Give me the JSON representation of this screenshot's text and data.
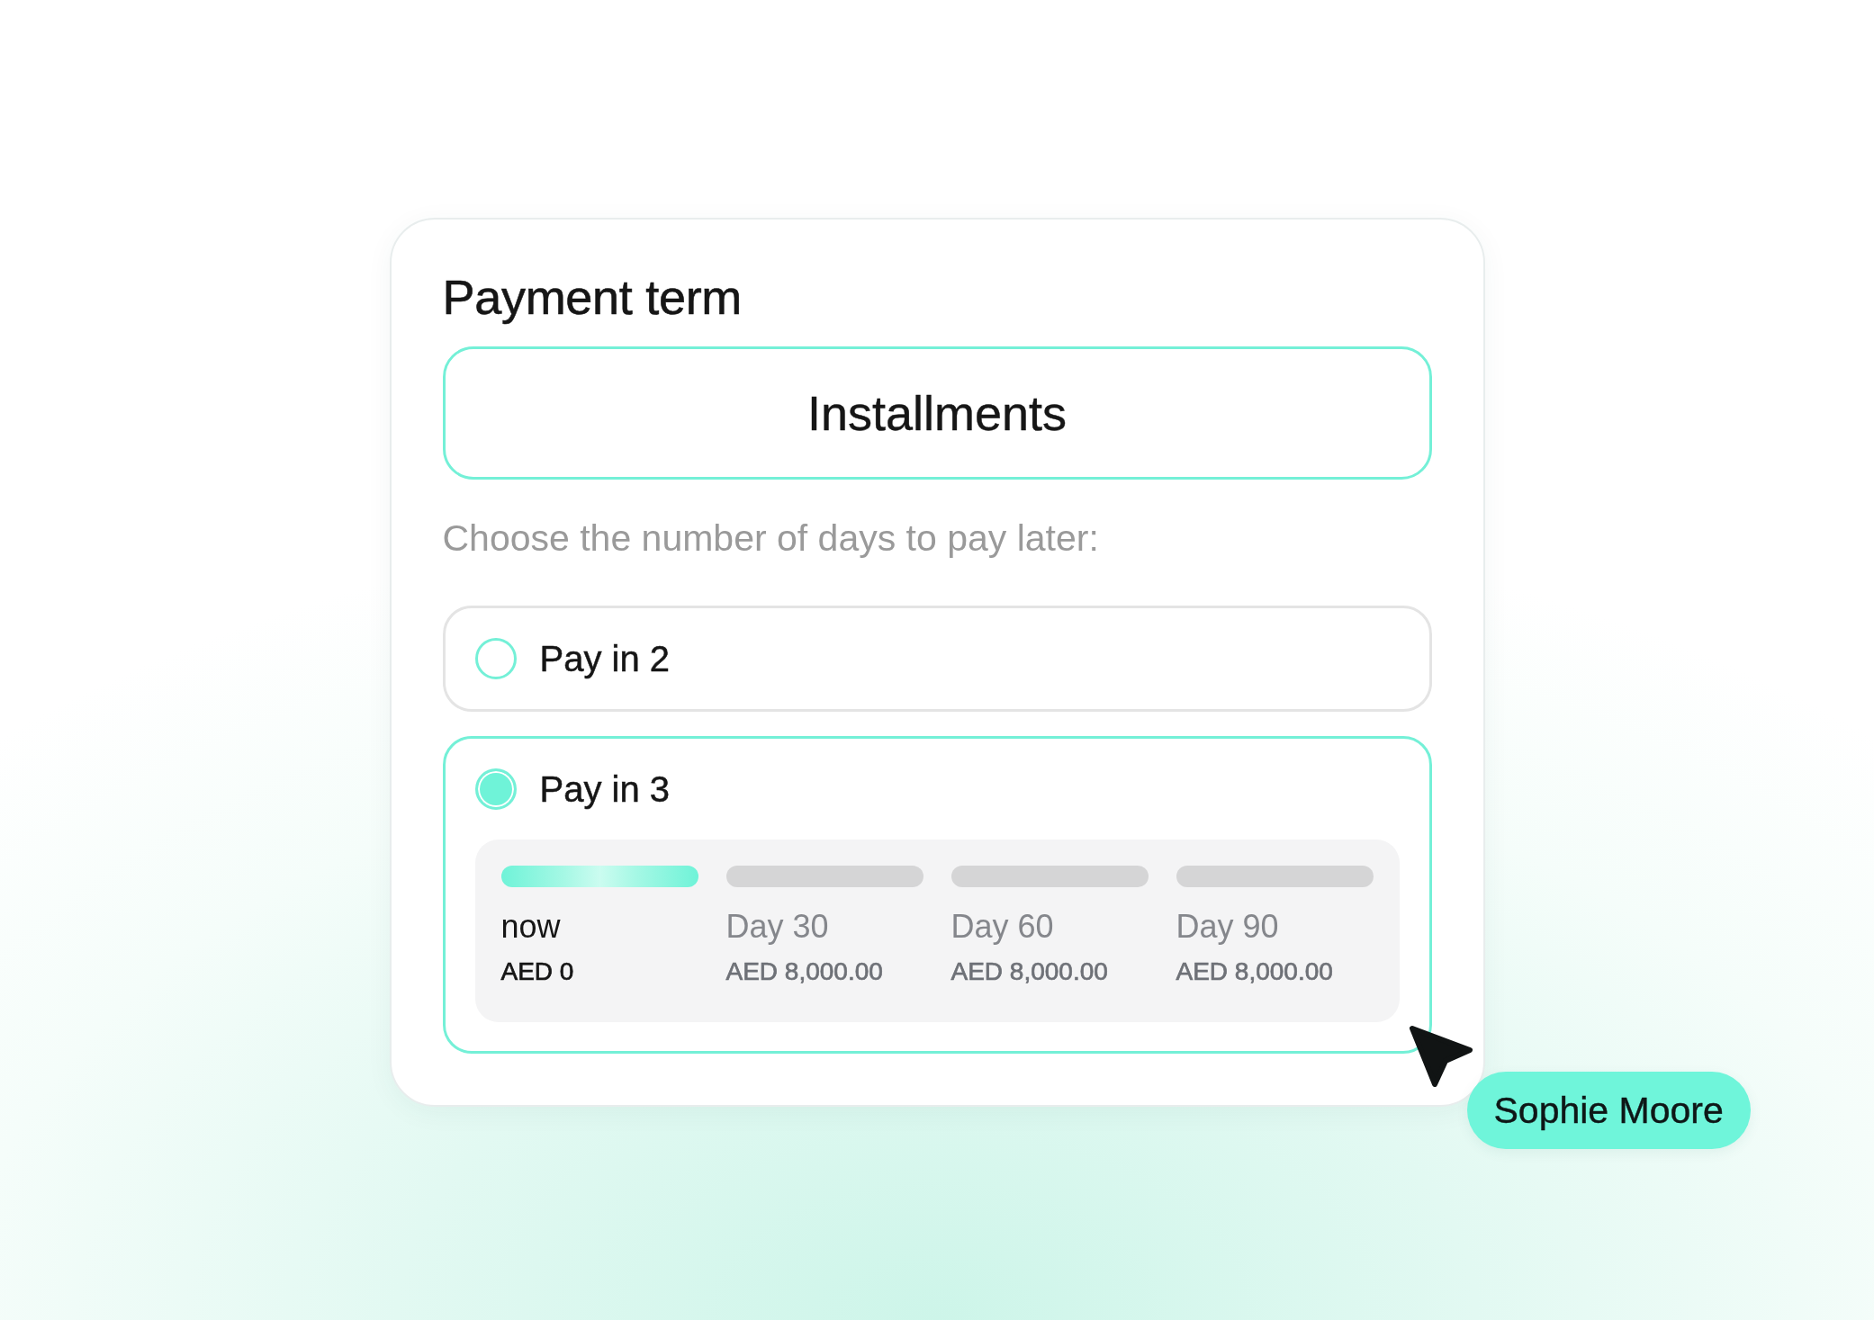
{
  "card": {
    "title": "Payment term",
    "payment_type": {
      "label": "Installments",
      "selected": true
    },
    "prompt": "Choose the number of days to pay later:",
    "options": [
      {
        "label": "Pay in 2",
        "selected": false
      },
      {
        "label": "Pay in 3",
        "selected": true,
        "schedule": [
          {
            "label": "now",
            "amount": "AED 0",
            "active": true
          },
          {
            "label": "Day 30",
            "amount": "AED 8,000.00",
            "active": false
          },
          {
            "label": "Day 60",
            "amount": "AED 8,000.00",
            "active": false
          },
          {
            "label": "Day 90",
            "amount": "AED 8,000.00",
            "active": false
          }
        ]
      }
    ]
  },
  "collaborator_cursor": {
    "name": "Sophie Moore"
  }
}
